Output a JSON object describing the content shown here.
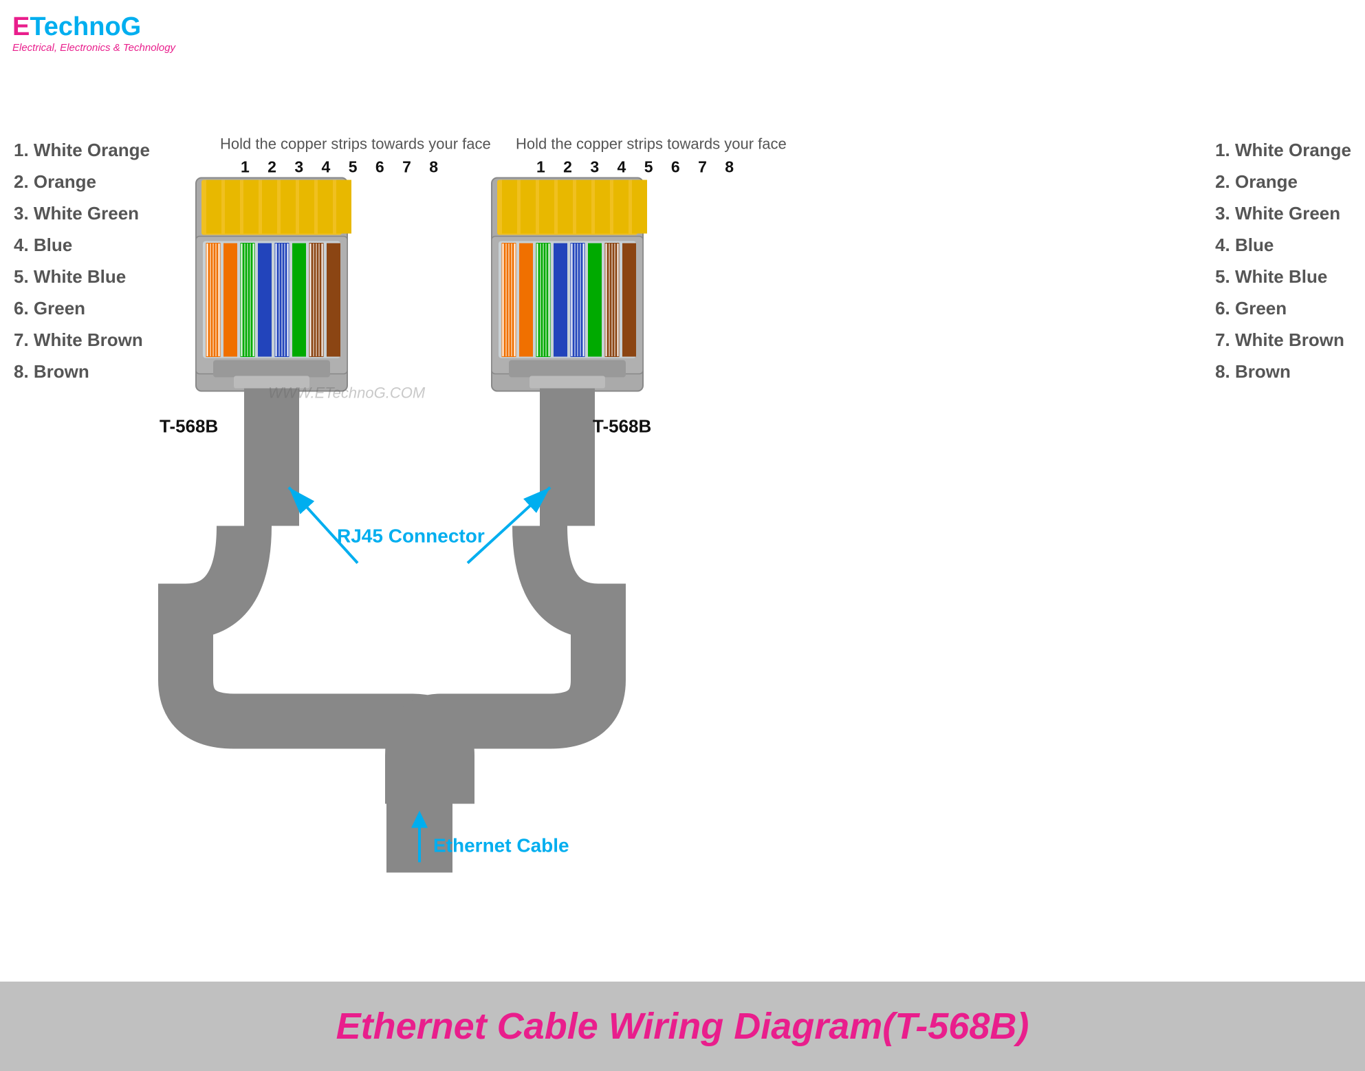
{
  "logo": {
    "e": "E",
    "technog": "TechnoG",
    "subtitle": "Electrical, Electronics & Technology"
  },
  "instruction": "Hold the copper strips towards your face",
  "pin_numbers": "1 2 3 4 5 6 7 8",
  "wire_labels": [
    "1. White Orange",
    "2. Orange",
    "3. White Green",
    "4. Blue",
    "5. White Blue",
    "6. Green",
    "7. White Brown",
    "8. Brown"
  ],
  "connector_type": "T-568B",
  "rj45_label": "RJ45 Connector",
  "ethernet_label": "Ethernet Cable",
  "watermark": "WWW.ETechnoG.COM",
  "footer_title": "Ethernet Cable Wiring Diagram(T-568B)"
}
